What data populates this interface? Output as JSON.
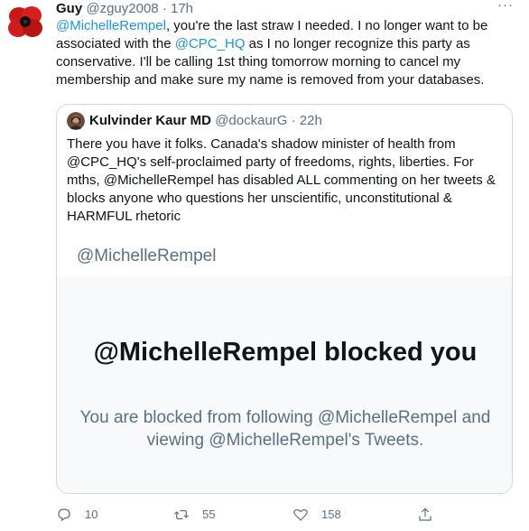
{
  "tweet": {
    "author_name": "Guy",
    "author_handle": "@zguy2008",
    "separator": "·",
    "time": "17h",
    "more_icon": "more-icon",
    "body": {
      "mention1": "@MichelleRempel",
      "part1": ", you're the last straw I needed.  I no longer want to be associated with the ",
      "mention2": "@CPC_HQ",
      "part2": " as I no longer recognize this party as conservative.  I'll be calling 1st thing tomorrow morning to cancel my membership and make sure my name is removed from your databases."
    }
  },
  "quote": {
    "author_name": "Kulvinder Kaur MD",
    "author_handle": "@dockaurG",
    "separator": "·",
    "time": "22h",
    "text": "There you have it folks. Canada's shadow minister of health from @CPC_HQ's self-proclaimed party of freedoms, rights, liberties. For mths, @MichelleRempel has disabled ALL commenting on her tweets & blocks anyone who questions her unscientific, unconstitutional & HARMFUL rhetoric",
    "image": {
      "top_handle": "@MichelleRempel",
      "blocked_title": "@MichelleRempel blocked you",
      "blocked_sub": "You are blocked from following @MichelleRempel and viewing @MichelleRempel's Tweets."
    }
  },
  "actions": {
    "reply_count": "10",
    "retweet_count": "55",
    "like_count": "158"
  },
  "colors": {
    "link": "#1b95e0",
    "muted": "#5b7083",
    "poppy_red": "#d01c1c"
  }
}
